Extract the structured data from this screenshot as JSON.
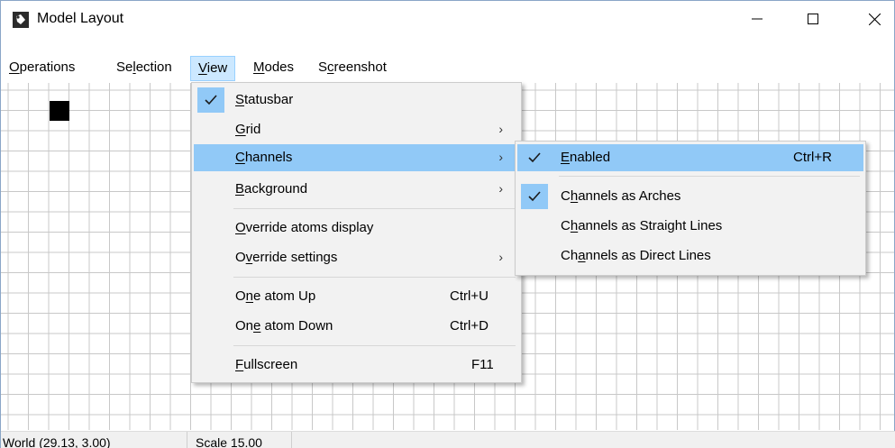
{
  "window": {
    "title": "Model Layout",
    "app_icon": "app-logo-icon",
    "controls": {
      "minimize": "minimize-icon",
      "maximize": "maximize-icon",
      "close": "close-icon"
    }
  },
  "menubar": {
    "items": [
      {
        "label_u": "O",
        "label_rest": "perations"
      },
      {
        "label_pre": "Se",
        "label_u": "l",
        "label_rest": "ection"
      },
      {
        "label_u": "V",
        "label_rest": "iew"
      },
      {
        "label_u": "M",
        "label_rest": "odes"
      },
      {
        "label_pre": "S",
        "label_u": "c",
        "label_rest": "reenshot"
      }
    ],
    "active": "View"
  },
  "view_menu": {
    "items": [
      {
        "u": "S",
        "rest": "tatusbar",
        "checked": true
      },
      {
        "u": "G",
        "rest": "rid",
        "submenu": true
      },
      {
        "u": "C",
        "rest": "hannels",
        "submenu": true,
        "highlighted": true
      },
      {
        "u": "B",
        "rest": "ackground",
        "submenu": true
      },
      {
        "u": "O",
        "rest": "verride atoms display"
      },
      {
        "pre": "O",
        "u": "v",
        "rest": "erride settings",
        "submenu": true
      },
      {
        "pre": "O",
        "u": "n",
        "rest": "e atom Up",
        "shortcut": "Ctrl+U"
      },
      {
        "pre": "On",
        "u": "e",
        "rest": " atom Down",
        "shortcut": "Ctrl+D"
      },
      {
        "u": "F",
        "rest": "ullscreen",
        "shortcut": "F11"
      }
    ]
  },
  "channels_menu": {
    "items": [
      {
        "u": "E",
        "rest": "nabled",
        "checked": true,
        "shortcut": "Ctrl+R",
        "highlighted": true
      },
      {
        "pre": "C",
        "u": "h",
        "rest": "annels as Arches",
        "checked": true
      },
      {
        "pre": "C",
        "u": "h",
        "rest": "annels as Straight Lines"
      },
      {
        "pre": "Ch",
        "u": "a",
        "rest": "nnels as Direct Lines"
      }
    ]
  },
  "statusbar": {
    "world": "World (29.13, 3.00)",
    "scale": "Scale 15.00"
  },
  "colors": {
    "menu_bg": "#f2f2f2",
    "highlight": "#91c9f7",
    "menubar_active": "#cce8ff",
    "grid_line": "#c8c8c8",
    "atom": "#000000"
  }
}
